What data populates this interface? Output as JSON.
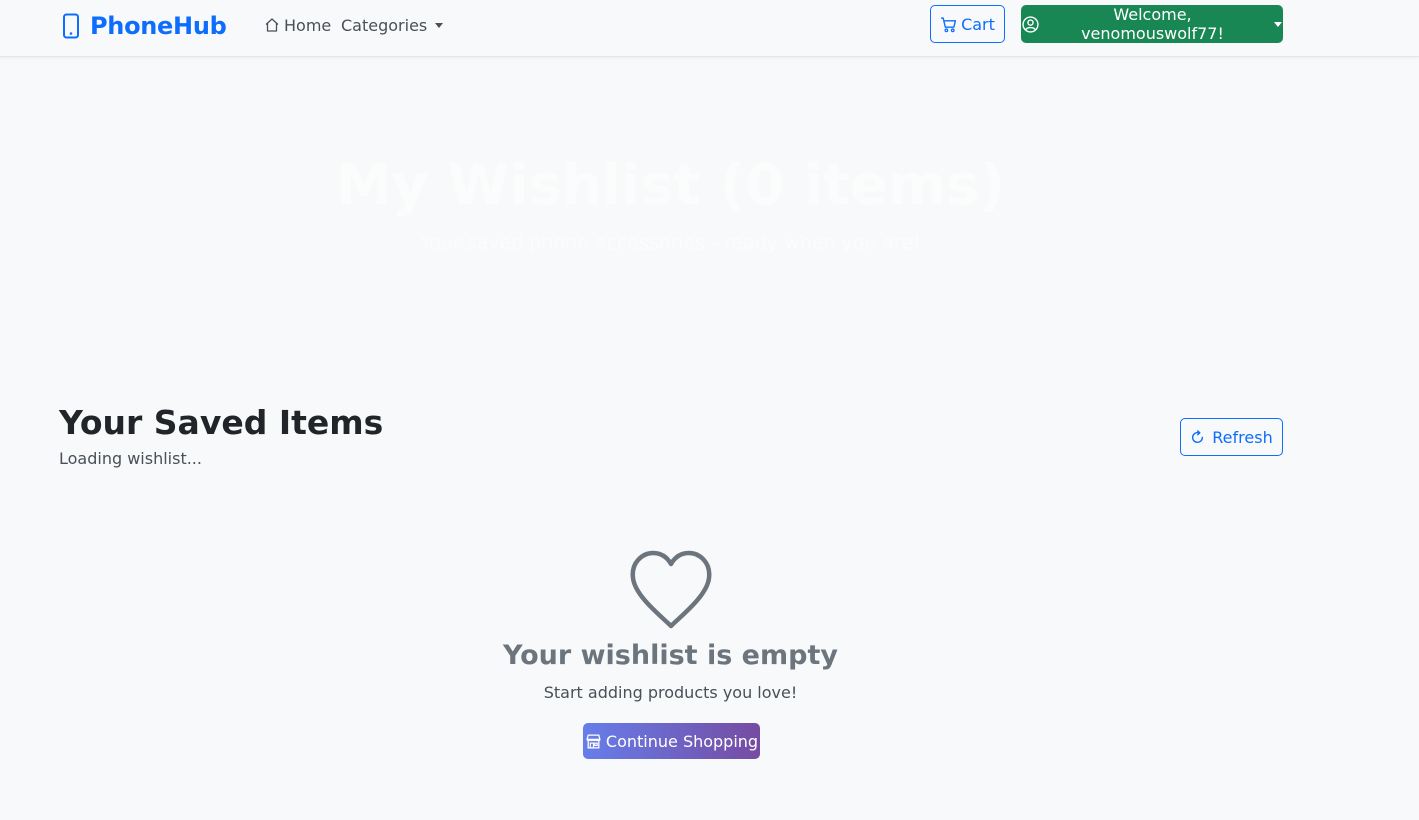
{
  "navbar": {
    "brand": "PhoneHub",
    "home_label": "Home",
    "categories_label": "Categories",
    "cart_label": "Cart",
    "user_label": "Welcome, venomouswolf77!"
  },
  "hero": {
    "title": "My Wishlist (0 items)",
    "subtitle": "Your saved phone accessories - ready when you are!"
  },
  "section": {
    "title": "Your Saved Items",
    "status": "Loading wishlist...",
    "refresh_label": "Refresh"
  },
  "empty_state": {
    "title": "Your wishlist is empty",
    "subtitle": "Start adding products you love!",
    "button_label": "Continue Shopping"
  },
  "colors": {
    "primary": "#0d6efd",
    "success": "#198754",
    "muted": "#6c757d",
    "gradient_start": "#667eea",
    "gradient_end": "#764ba2"
  },
  "icons": {
    "brand": "phone-icon",
    "home": "house-icon",
    "cart": "cart-icon",
    "user": "person-circle-icon",
    "refresh": "refresh-icon",
    "empty": "heart-icon",
    "shop": "shop-icon"
  }
}
